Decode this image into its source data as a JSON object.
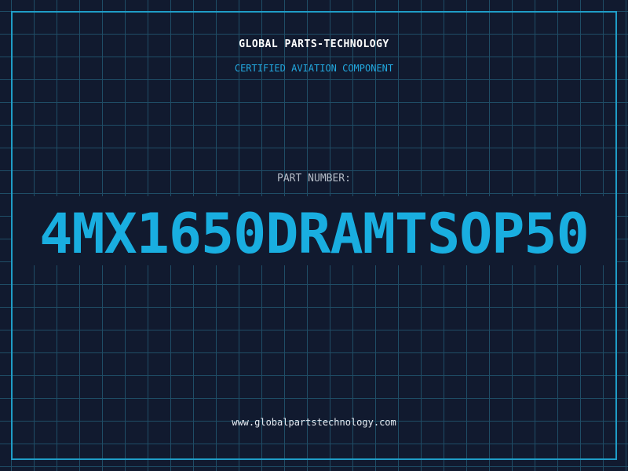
{
  "header": {
    "title": "GLOBAL PARTS-TECHNOLOGY",
    "subtitle": "CERTIFIED AVIATION COMPONENT"
  },
  "part": {
    "label": "PART NUMBER:",
    "number": "4MX1650DRAMTSOP50"
  },
  "footer": {
    "url": "www.globalpartstechnology.com"
  },
  "colors": {
    "background": "#111a2f",
    "grid": "#1f4d66",
    "accent": "#19aee0",
    "frame": "#1f9dc7"
  }
}
